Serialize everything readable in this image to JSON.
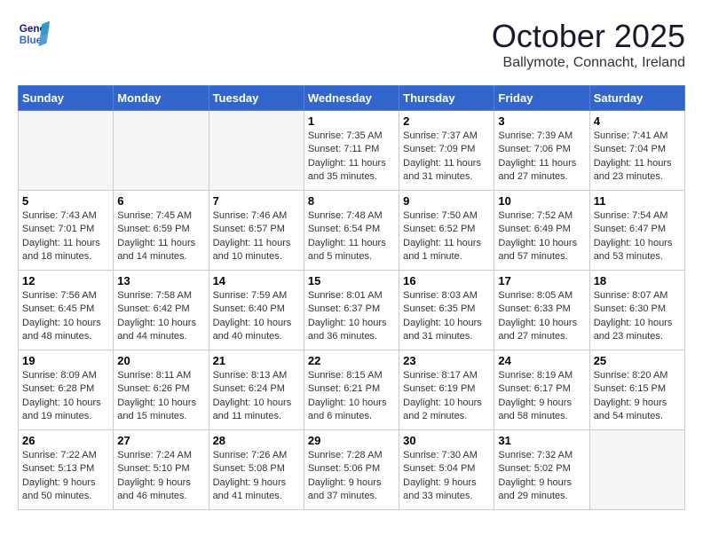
{
  "header": {
    "logo_line1": "General",
    "logo_line2": "Blue",
    "month": "October 2025",
    "location": "Ballymote, Connacht, Ireland"
  },
  "weekdays": [
    "Sunday",
    "Monday",
    "Tuesday",
    "Wednesday",
    "Thursday",
    "Friday",
    "Saturday"
  ],
  "weeks": [
    [
      {
        "day": "",
        "empty": true
      },
      {
        "day": "",
        "empty": true
      },
      {
        "day": "",
        "empty": true
      },
      {
        "day": "1",
        "info": "Sunrise: 7:35 AM\nSunset: 7:11 PM\nDaylight: 11 hours\nand 35 minutes."
      },
      {
        "day": "2",
        "info": "Sunrise: 7:37 AM\nSunset: 7:09 PM\nDaylight: 11 hours\nand 31 minutes."
      },
      {
        "day": "3",
        "info": "Sunrise: 7:39 AM\nSunset: 7:06 PM\nDaylight: 11 hours\nand 27 minutes."
      },
      {
        "day": "4",
        "info": "Sunrise: 7:41 AM\nSunset: 7:04 PM\nDaylight: 11 hours\nand 23 minutes."
      }
    ],
    [
      {
        "day": "5",
        "info": "Sunrise: 7:43 AM\nSunset: 7:01 PM\nDaylight: 11 hours\nand 18 minutes."
      },
      {
        "day": "6",
        "info": "Sunrise: 7:45 AM\nSunset: 6:59 PM\nDaylight: 11 hours\nand 14 minutes."
      },
      {
        "day": "7",
        "info": "Sunrise: 7:46 AM\nSunset: 6:57 PM\nDaylight: 11 hours\nand 10 minutes."
      },
      {
        "day": "8",
        "info": "Sunrise: 7:48 AM\nSunset: 6:54 PM\nDaylight: 11 hours\nand 5 minutes."
      },
      {
        "day": "9",
        "info": "Sunrise: 7:50 AM\nSunset: 6:52 PM\nDaylight: 11 hours\nand 1 minute."
      },
      {
        "day": "10",
        "info": "Sunrise: 7:52 AM\nSunset: 6:49 PM\nDaylight: 10 hours\nand 57 minutes."
      },
      {
        "day": "11",
        "info": "Sunrise: 7:54 AM\nSunset: 6:47 PM\nDaylight: 10 hours\nand 53 minutes."
      }
    ],
    [
      {
        "day": "12",
        "info": "Sunrise: 7:56 AM\nSunset: 6:45 PM\nDaylight: 10 hours\nand 48 minutes."
      },
      {
        "day": "13",
        "info": "Sunrise: 7:58 AM\nSunset: 6:42 PM\nDaylight: 10 hours\nand 44 minutes."
      },
      {
        "day": "14",
        "info": "Sunrise: 7:59 AM\nSunset: 6:40 PM\nDaylight: 10 hours\nand 40 minutes."
      },
      {
        "day": "15",
        "info": "Sunrise: 8:01 AM\nSunset: 6:37 PM\nDaylight: 10 hours\nand 36 minutes."
      },
      {
        "day": "16",
        "info": "Sunrise: 8:03 AM\nSunset: 6:35 PM\nDaylight: 10 hours\nand 31 minutes."
      },
      {
        "day": "17",
        "info": "Sunrise: 8:05 AM\nSunset: 6:33 PM\nDaylight: 10 hours\nand 27 minutes."
      },
      {
        "day": "18",
        "info": "Sunrise: 8:07 AM\nSunset: 6:30 PM\nDaylight: 10 hours\nand 23 minutes."
      }
    ],
    [
      {
        "day": "19",
        "info": "Sunrise: 8:09 AM\nSunset: 6:28 PM\nDaylight: 10 hours\nand 19 minutes."
      },
      {
        "day": "20",
        "info": "Sunrise: 8:11 AM\nSunset: 6:26 PM\nDaylight: 10 hours\nand 15 minutes."
      },
      {
        "day": "21",
        "info": "Sunrise: 8:13 AM\nSunset: 6:24 PM\nDaylight: 10 hours\nand 11 minutes."
      },
      {
        "day": "22",
        "info": "Sunrise: 8:15 AM\nSunset: 6:21 PM\nDaylight: 10 hours\nand 6 minutes."
      },
      {
        "day": "23",
        "info": "Sunrise: 8:17 AM\nSunset: 6:19 PM\nDaylight: 10 hours\nand 2 minutes."
      },
      {
        "day": "24",
        "info": "Sunrise: 8:19 AM\nSunset: 6:17 PM\nDaylight: 9 hours\nand 58 minutes."
      },
      {
        "day": "25",
        "info": "Sunrise: 8:20 AM\nSunset: 6:15 PM\nDaylight: 9 hours\nand 54 minutes."
      }
    ],
    [
      {
        "day": "26",
        "info": "Sunrise: 7:22 AM\nSunset: 5:13 PM\nDaylight: 9 hours\nand 50 minutes."
      },
      {
        "day": "27",
        "info": "Sunrise: 7:24 AM\nSunset: 5:10 PM\nDaylight: 9 hours\nand 46 minutes."
      },
      {
        "day": "28",
        "info": "Sunrise: 7:26 AM\nSunset: 5:08 PM\nDaylight: 9 hours\nand 41 minutes."
      },
      {
        "day": "29",
        "info": "Sunrise: 7:28 AM\nSunset: 5:06 PM\nDaylight: 9 hours\nand 37 minutes."
      },
      {
        "day": "30",
        "info": "Sunrise: 7:30 AM\nSunset: 5:04 PM\nDaylight: 9 hours\nand 33 minutes."
      },
      {
        "day": "31",
        "info": "Sunrise: 7:32 AM\nSunset: 5:02 PM\nDaylight: 9 hours\nand 29 minutes."
      },
      {
        "day": "",
        "empty": true
      }
    ]
  ]
}
